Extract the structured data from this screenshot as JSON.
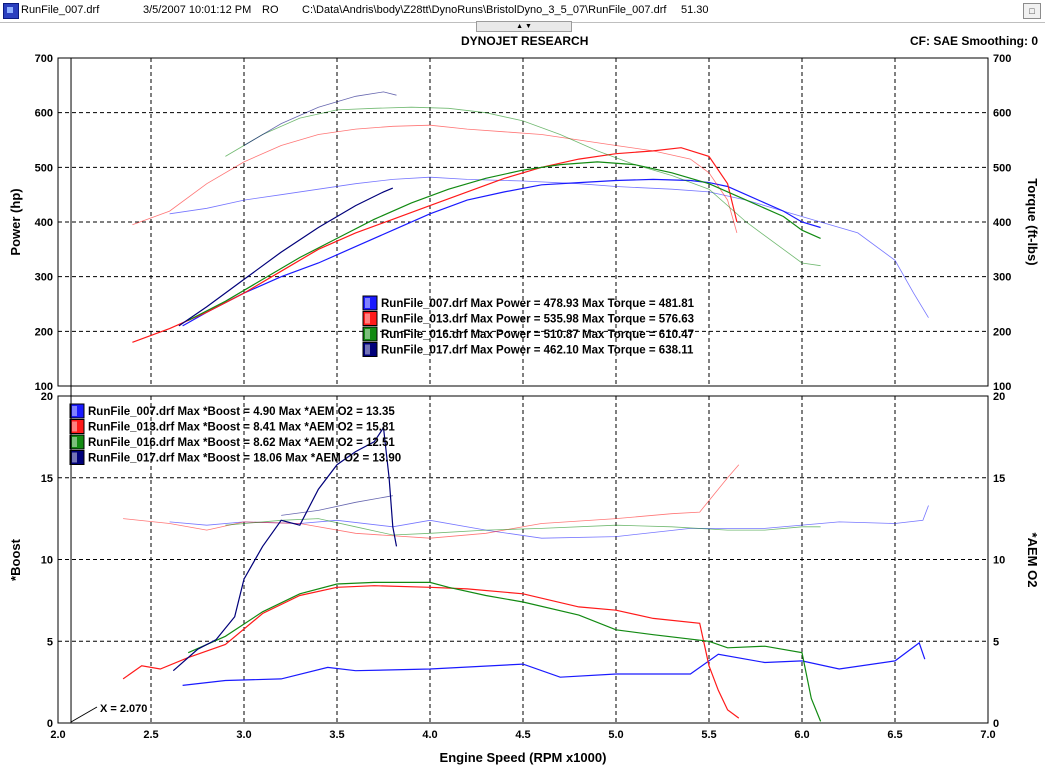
{
  "window": {
    "file_name": "RunFile_007.drf",
    "datetime": "3/5/2007 10:01:12 PM",
    "mode": "RO",
    "path": "C:\\Data\\Andris\\body\\Z28tt\\DynoRuns\\BristolDyno_3_5_07\\RunFile_007.drf",
    "value": "51.30",
    "splitter_glyph": "▲ ▼"
  },
  "header": {
    "title": "DYNOJET RESEARCH",
    "settings": "CF: SAE  Smoothing: 0"
  },
  "colors": {
    "run007": "#1a1aff",
    "run013": "#ff1a1a",
    "run016": "#128a12",
    "run017": "#00007a"
  },
  "chart_data": [
    {
      "type": "line",
      "panel": "top",
      "ylabel": "Power (hp)",
      "y2label": "Torque (ft-lbs)",
      "ylim": [
        100,
        700
      ],
      "y2lim": [
        100,
        700
      ],
      "xlim": [
        2.0,
        7.0
      ],
      "yticks": [
        "100",
        "200",
        "300",
        "400",
        "500",
        "600",
        "700"
      ],
      "legend": [
        "RunFile_007.drf Max Power = 478.93 Max Torque = 481.81",
        "RunFile_013.drf Max Power = 535.98 Max Torque = 576.63",
        "RunFile_016.drf Max Power = 510.87 Max Torque = 610.47",
        "RunFile_017.drf Max Power = 462.10 Max Torque = 638.11"
      ],
      "series": [
        {
          "run": "007",
          "kind": "power",
          "color": "#1a1aff",
          "x": [
            2.67,
            2.8,
            3.0,
            3.2,
            3.4,
            3.6,
            3.8,
            4.0,
            4.2,
            4.4,
            4.6,
            4.8,
            5.0,
            5.2,
            5.4,
            5.5,
            5.6,
            5.7,
            5.8,
            5.9,
            6.0,
            6.1
          ],
          "y": [
            210,
            235,
            270,
            300,
            325,
            355,
            385,
            415,
            440,
            455,
            468,
            472,
            476,
            478,
            476,
            472,
            465,
            450,
            435,
            420,
            400,
            390
          ]
        },
        {
          "run": "007",
          "kind": "torque",
          "color": "#1a1aff",
          "x": [
            2.6,
            2.8,
            3.0,
            3.2,
            3.4,
            3.6,
            3.8,
            4.0,
            4.2,
            4.5,
            4.8,
            5.0,
            5.3,
            5.5,
            5.7,
            5.9,
            6.1,
            6.3,
            6.5,
            6.6,
            6.68
          ],
          "y": [
            415,
            425,
            440,
            450,
            460,
            470,
            478,
            482,
            478,
            475,
            470,
            465,
            460,
            455,
            440,
            420,
            400,
            380,
            330,
            270,
            225
          ]
        },
        {
          "run": "013",
          "kind": "power",
          "color": "#ff1a1a",
          "x": [
            2.4,
            2.6,
            2.8,
            3.0,
            3.2,
            3.4,
            3.6,
            3.8,
            4.0,
            4.2,
            4.4,
            4.6,
            4.8,
            5.0,
            5.2,
            5.35,
            5.5,
            5.6,
            5.65
          ],
          "y": [
            180,
            205,
            235,
            270,
            310,
            350,
            380,
            405,
            430,
            455,
            480,
            500,
            515,
            525,
            530,
            536,
            520,
            470,
            400
          ]
        },
        {
          "run": "013",
          "kind": "torque",
          "color": "#ff1a1a",
          "x": [
            2.4,
            2.6,
            2.8,
            3.0,
            3.2,
            3.4,
            3.6,
            3.8,
            4.0,
            4.2,
            4.4,
            4.6,
            4.8,
            5.0,
            5.2,
            5.4,
            5.5,
            5.6,
            5.65
          ],
          "y": [
            395,
            420,
            470,
            510,
            540,
            560,
            570,
            575,
            577,
            570,
            565,
            560,
            550,
            540,
            530,
            515,
            490,
            440,
            380
          ]
        },
        {
          "run": "016",
          "kind": "power",
          "color": "#128a12",
          "x": [
            2.7,
            2.9,
            3.1,
            3.3,
            3.5,
            3.7,
            3.9,
            4.1,
            4.3,
            4.5,
            4.7,
            4.9,
            5.1,
            5.3,
            5.5,
            5.7,
            5.9,
            6.0,
            6.1
          ],
          "y": [
            220,
            255,
            295,
            335,
            370,
            405,
            435,
            460,
            480,
            495,
            505,
            510,
            505,
            490,
            470,
            440,
            410,
            385,
            370
          ]
        },
        {
          "run": "016",
          "kind": "torque",
          "color": "#128a12",
          "x": [
            2.9,
            3.1,
            3.3,
            3.5,
            3.7,
            3.9,
            4.1,
            4.3,
            4.5,
            4.7,
            4.9,
            5.1,
            5.3,
            5.5,
            5.7,
            5.9,
            6.0,
            6.1
          ],
          "y": [
            520,
            560,
            590,
            605,
            608,
            610,
            608,
            600,
            585,
            560,
            530,
            505,
            485,
            460,
            400,
            350,
            325,
            320
          ]
        },
        {
          "run": "017",
          "kind": "power",
          "color": "#00007a",
          "x": [
            2.65,
            2.8,
            3.0,
            3.2,
            3.4,
            3.6,
            3.75,
            3.8
          ],
          "y": [
            210,
            245,
            295,
            345,
            390,
            430,
            455,
            462
          ]
        },
        {
          "run": "017",
          "kind": "torque",
          "color": "#00007a",
          "x": [
            3.0,
            3.2,
            3.4,
            3.6,
            3.75,
            3.82
          ],
          "y": [
            540,
            580,
            610,
            630,
            638,
            632
          ]
        }
      ]
    },
    {
      "type": "line",
      "panel": "bottom",
      "ylabel": "*Boost",
      "y2label": "*AEM O2",
      "ylim": [
        0,
        20
      ],
      "y2lim": [
        0,
        20
      ],
      "xlim": [
        2.0,
        7.0
      ],
      "xlabel": "Engine Speed (RPM x1000)",
      "xticks": [
        "2.0",
        "2.5",
        "3.0",
        "3.5",
        "4.0",
        "4.5",
        "5.0",
        "5.5",
        "6.0",
        "6.5",
        "7.0"
      ],
      "yticks": [
        "0",
        "5",
        "10",
        "15",
        "20"
      ],
      "cursor_label": "X = 2.070",
      "cursor_x": 2.07,
      "legend": [
        "RunFile_007.drf Max *Boost = 4.90 Max *AEM O2 = 13.35",
        "RunFile_013.drf Max *Boost = 8.41 Max *AEM O2 = 15.81",
        "RunFile_016.drf Max *Boost = 8.62 Max *AEM O2 = 12.51",
        "RunFile_017.drf Max *Boost = 18.06 Max *AEM O2 = 13.90"
      ],
      "series": [
        {
          "run": "007",
          "kind": "boost",
          "color": "#1a1aff",
          "x": [
            2.67,
            2.9,
            3.2,
            3.45,
            3.6,
            4.0,
            4.5,
            4.7,
            5.0,
            5.4,
            5.55,
            5.8,
            6.0,
            6.2,
            6.5,
            6.63,
            6.66
          ],
          "y": [
            2.3,
            2.6,
            2.7,
            3.4,
            3.2,
            3.3,
            3.6,
            2.8,
            3.0,
            3.0,
            4.2,
            3.7,
            3.8,
            3.3,
            3.8,
            4.9,
            3.9
          ]
        },
        {
          "run": "007",
          "kind": "o2",
          "color": "#1a1aff",
          "x": [
            2.6,
            2.8,
            3.0,
            3.3,
            3.5,
            3.8,
            4.0,
            4.3,
            4.6,
            5.0,
            5.4,
            5.8,
            6.2,
            6.5,
            6.65,
            6.68
          ],
          "y": [
            12.3,
            12.1,
            12.3,
            12.2,
            12.4,
            12.0,
            12.4,
            11.8,
            11.3,
            11.4,
            11.9,
            11.9,
            12.3,
            12.2,
            12.4,
            13.3
          ]
        },
        {
          "run": "013",
          "kind": "boost",
          "color": "#ff1a1a",
          "x": [
            2.35,
            2.45,
            2.55,
            2.7,
            2.9,
            3.1,
            3.3,
            3.5,
            3.7,
            4.0,
            4.2,
            4.5,
            4.8,
            5.0,
            5.2,
            5.45,
            5.5,
            5.55,
            5.6,
            5.66
          ],
          "y": [
            2.7,
            3.5,
            3.3,
            4.0,
            4.8,
            6.7,
            7.8,
            8.3,
            8.4,
            8.3,
            8.2,
            7.9,
            7.1,
            6.9,
            6.4,
            6.1,
            3.5,
            2.0,
            0.8,
            0.3
          ]
        },
        {
          "run": "013",
          "kind": "o2",
          "color": "#ff1a1a",
          "x": [
            2.35,
            2.6,
            2.8,
            3.0,
            3.3,
            3.6,
            4.0,
            4.3,
            4.6,
            5.0,
            5.3,
            5.45,
            5.5,
            5.6,
            5.66
          ],
          "y": [
            12.5,
            12.2,
            11.8,
            12.3,
            12.2,
            11.6,
            11.3,
            11.6,
            12.2,
            12.5,
            12.8,
            12.9,
            13.6,
            15.0,
            15.8
          ]
        },
        {
          "run": "016",
          "kind": "boost",
          "color": "#128a12",
          "x": [
            2.7,
            2.9,
            3.1,
            3.3,
            3.5,
            3.7,
            4.0,
            4.1,
            4.3,
            4.5,
            4.8,
            5.0,
            5.2,
            5.5,
            5.6,
            5.8,
            6.0,
            6.05,
            6.1
          ],
          "y": [
            4.3,
            5.3,
            6.8,
            7.9,
            8.5,
            8.6,
            8.6,
            8.3,
            7.8,
            7.4,
            6.6,
            5.7,
            5.4,
            5.0,
            4.6,
            4.7,
            4.3,
            1.5,
            0.1
          ]
        },
        {
          "run": "016",
          "kind": "o2",
          "color": "#128a12",
          "x": [
            2.9,
            3.2,
            3.4,
            3.6,
            3.8,
            4.0,
            4.3,
            4.6,
            5.0,
            5.3,
            5.6,
            5.8,
            6.0,
            6.1
          ],
          "y": [
            12.1,
            12.4,
            12.5,
            12.0,
            11.5,
            11.6,
            11.8,
            11.9,
            12.1,
            12.0,
            11.8,
            11.8,
            12.0,
            12.0
          ]
        },
        {
          "run": "017",
          "kind": "boost",
          "color": "#00007a",
          "x": [
            2.62,
            2.75,
            2.85,
            2.95,
            3.0,
            3.1,
            3.2,
            3.3,
            3.4,
            3.5,
            3.6,
            3.7,
            3.75,
            3.78,
            3.8,
            3.82
          ],
          "y": [
            3.2,
            4.5,
            5.1,
            6.5,
            8.8,
            10.8,
            12.4,
            12.1,
            14.3,
            15.8,
            16.6,
            17.2,
            18.06,
            15.0,
            12.0,
            10.8
          ]
        },
        {
          "run": "017",
          "kind": "o2",
          "color": "#00007a",
          "x": [
            3.2,
            3.4,
            3.6,
            3.8
          ],
          "y": [
            12.7,
            13.0,
            13.5,
            13.9
          ]
        }
      ]
    }
  ]
}
